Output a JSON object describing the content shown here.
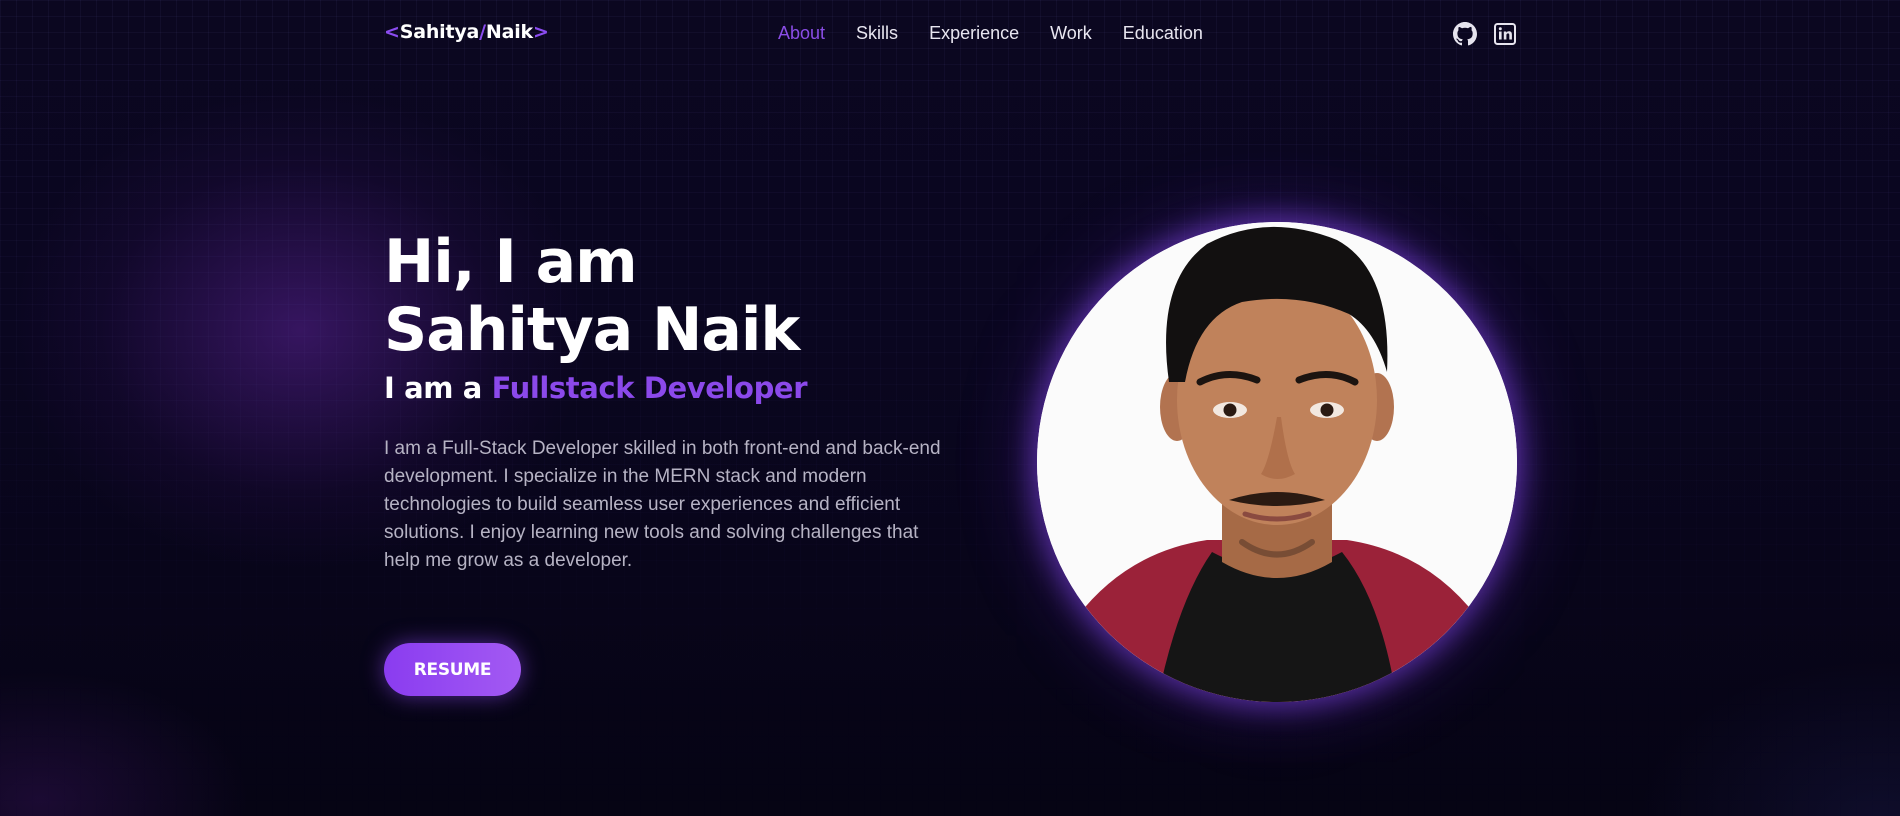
{
  "logo": {
    "open": "<",
    "first": "Sahitya",
    "slash": "/",
    "last": "Naik",
    "close": ">"
  },
  "nav": {
    "items": [
      {
        "label": "About",
        "active": true
      },
      {
        "label": "Skills"
      },
      {
        "label": "Experience"
      },
      {
        "label": "Work"
      },
      {
        "label": "Education"
      }
    ]
  },
  "social": {
    "icons": [
      "github-icon",
      "linkedin-icon"
    ]
  },
  "hero": {
    "title_line1": "Hi, I am",
    "title_line2": "Sahitya Naik",
    "subtitle_prefix": "I am a ",
    "subtitle_role": "Fullstack Developer",
    "description": "I am a Full-Stack Developer skilled in both front-end and back-end development. I specialize in the MERN stack and modern technologies to build seamless user experiences and efficient solutions. I enjoy learning new tools and solving challenges that help me grow as a developer.",
    "resume_label": "RESUME"
  },
  "colors": {
    "accent": "#8b49ea",
    "background": "#0a0620",
    "text": "#ffffff",
    "muted_text": "#b6b3c4"
  }
}
